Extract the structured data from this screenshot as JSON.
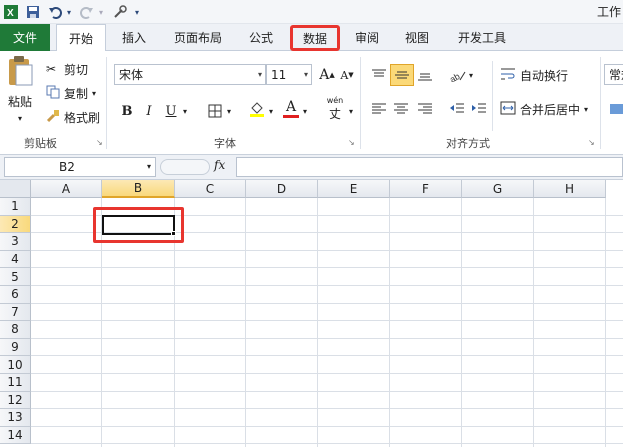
{
  "app": {
    "title": "工作",
    "accent": "#1f7a38",
    "highlight": "#e8352f"
  },
  "qat": {
    "excel_icon": "excel-logo-icon",
    "save_icon": "save-icon",
    "undo_icon": "undo-icon",
    "redo_icon": "redo-icon",
    "customize_icon": "customize-icon"
  },
  "tabs": {
    "file": "文件",
    "home": "开始",
    "insert": "插入",
    "layout": "页面布局",
    "formulas": "公式",
    "data": "数据",
    "review": "审阅",
    "view": "视图",
    "developer": "开发工具"
  },
  "clipboard": {
    "paste": "粘贴",
    "cut": "剪切",
    "copy": "复制",
    "format_painter": "格式刷",
    "label": "剪贴板"
  },
  "font": {
    "name": "宋体",
    "size": "11",
    "label": "字体",
    "bold": "B",
    "italic": "I",
    "underline": "U",
    "wen": "wén",
    "grow": "A",
    "shrink": "A",
    "font_color": "A"
  },
  "alignment": {
    "wrap": "自动换行",
    "merge": "合并后居中",
    "label": "对齐方式"
  },
  "number": {
    "format": "常规"
  },
  "formula_bar": {
    "cell_ref": "B2",
    "fx": "fx",
    "content": ""
  },
  "grid": {
    "columns": [
      "A",
      "B",
      "C",
      "D",
      "E",
      "F",
      "G",
      "H"
    ],
    "rows": [
      "1",
      "2",
      "3",
      "4",
      "5",
      "6",
      "7",
      "8",
      "9",
      "10",
      "11",
      "12",
      "13",
      "14"
    ],
    "selected_column": "B",
    "selected_row": "2"
  }
}
